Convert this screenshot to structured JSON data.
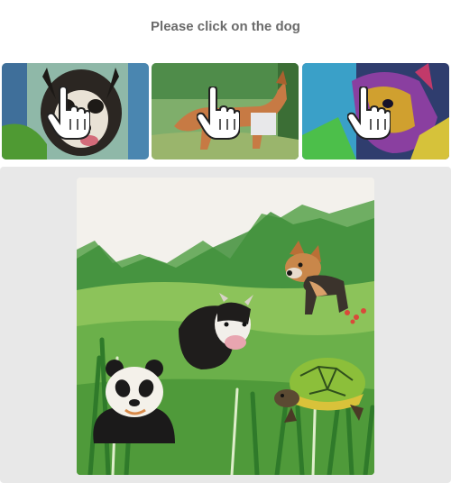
{
  "captcha": {
    "instruction": "Please click on the dog"
  },
  "examples": [
    {
      "icon": "hand-pointer-icon",
      "subject": "dog-portrait"
    },
    {
      "icon": "hand-pointer-icon",
      "subject": "dog-walking"
    },
    {
      "icon": "hand-pointer-icon",
      "subject": "dog-colorful"
    }
  ],
  "board": {
    "animals": [
      "dog",
      "cow",
      "panda",
      "turtle"
    ]
  },
  "colors": {
    "title": "#6b6b6b",
    "panel": "#e8e8e8",
    "grass": "#5aa83a",
    "hills": "#3f8f3a",
    "sky": "#f3f1ec"
  }
}
